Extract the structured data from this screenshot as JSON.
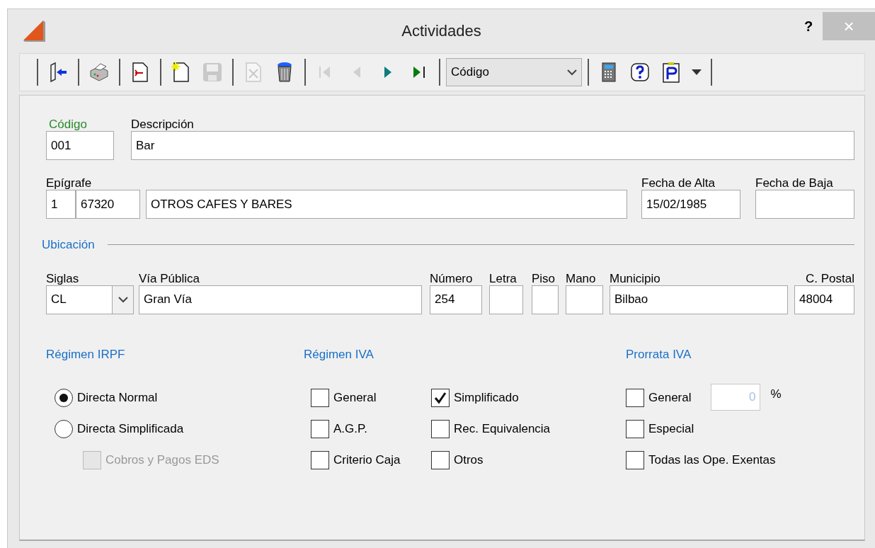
{
  "window": {
    "title": "Actividades",
    "help": "?",
    "close": "×"
  },
  "toolbar": [
    {
      "kind": "separator"
    },
    {
      "kind": "button",
      "disabled": false
    },
    {
      "kind": "separator"
    },
    {
      "kind": "button",
      "disabled": false
    },
    {
      "kind": "separator"
    },
    {
      "kind": "button",
      "disabled": false
    },
    {
      "kind": "separator"
    },
    {
      "kind": "button",
      "disabled": false
    },
    {
      "kind": "button",
      "disabled": true
    },
    {
      "kind": "separator"
    },
    {
      "kind": "button",
      "disabled": true
    },
    {
      "kind": "button",
      "disabled": false
    },
    {
      "kind": "separator"
    },
    {
      "kind": "button",
      "disabled": true
    },
    {
      "kind": "button",
      "disabled": true
    },
    {
      "kind": "button",
      "disabled": false
    },
    {
      "kind": "button",
      "disabled": false
    },
    {
      "kind": "separator"
    },
    {
      "kind": "combo",
      "value": "Código"
    },
    {
      "kind": "separator"
    },
    {
      "kind": "button",
      "disabled": false
    },
    {
      "kind": "button",
      "disabled": false
    },
    {
      "kind": "button",
      "disabled": false
    },
    {
      "kind": "menu"
    },
    {
      "kind": "separator"
    }
  ],
  "identity": [
    {
      "label": "Código",
      "emphasized": true,
      "value": "001"
    },
    {
      "label": "Descripción",
      "emphasized": false,
      "value": "Bar"
    }
  ],
  "epigrafe": {
    "label": "Epígrafe",
    "values": [
      "1",
      "67320",
      "OTROS CAFES Y BARES"
    ]
  },
  "dates": [
    {
      "label": "Fecha de Alta",
      "value": "15/02/1985"
    },
    {
      "label": "Fecha de Baja"
    }
  ],
  "ubicacion": {
    "title": "Ubicación",
    "fields": [
      {
        "label": "Siglas",
        "value": "CL",
        "kind": "select"
      },
      {
        "label": "Vía Pública",
        "value": "Gran Vía",
        "kind": "text"
      },
      {
        "label": "Número",
        "value": "254",
        "kind": "text"
      },
      {
        "label": "Letra",
        "kind": "text"
      },
      {
        "label": "Piso",
        "kind": "text"
      },
      {
        "label": "Mano",
        "kind": "text"
      },
      {
        "label": "Municipio",
        "value": "Bilbao",
        "kind": "text"
      },
      {
        "label": "C. Postal",
        "value": "48004",
        "kind": "text"
      }
    ]
  },
  "irpf": {
    "title": "Régimen IRPF",
    "options": [
      {
        "label": "Directa Normal",
        "kind": "radio",
        "selected": true,
        "disabled": false
      },
      {
        "label": "Directa Simplificada",
        "kind": "radio",
        "selected": false,
        "disabled": false
      },
      {
        "label": "Cobros y Pagos EDS",
        "kind": "checkbox",
        "checked": false,
        "disabled": true
      }
    ]
  },
  "iva": {
    "title": "Régimen IVA",
    "options": [
      {
        "label": "General",
        "kind": "checkbox",
        "checked": false,
        "disabled": false
      },
      {
        "label": "A.G.P.",
        "kind": "checkbox",
        "checked": false,
        "disabled": false
      },
      {
        "label": "Criterio Caja",
        "kind": "checkbox",
        "checked": false,
        "disabled": false
      },
      {
        "label": "Simplificado",
        "kind": "checkbox",
        "checked": true,
        "disabled": false
      },
      {
        "label": "Rec. Equivalencia",
        "kind": "checkbox",
        "checked": false,
        "disabled": false
      },
      {
        "label": "Otros",
        "kind": "checkbox",
        "checked": false,
        "disabled": false
      }
    ]
  },
  "prorrata": {
    "title": "Prorrata IVA",
    "options": [
      {
        "label": "General",
        "kind": "checkbox",
        "checked": false,
        "disabled": false
      },
      {
        "label": "Especial",
        "kind": "checkbox",
        "checked": false,
        "disabled": false
      },
      {
        "label": "Todas las Ope. Exentas",
        "kind": "checkbox",
        "checked": false,
        "disabled": false
      }
    ],
    "percent": {
      "value": "0",
      "unit": "%",
      "disabled": true
    }
  }
}
